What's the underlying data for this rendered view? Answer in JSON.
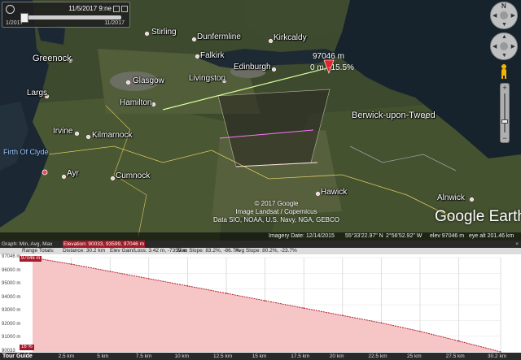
{
  "time_slider": {
    "current": "11/5/2017 9:ne",
    "start": "1/2017",
    "end": "11/2017"
  },
  "map": {
    "places": {
      "stirling": "Stirling",
      "dunfermline": "Dunfermline",
      "kirkcaldy": "Kirkcaldy",
      "greenock": "Greenock",
      "falkirk": "Falkirk",
      "glasgow": "Glasgow",
      "livingston": "Livingston",
      "edinburgh": "Edinburgh",
      "largs": "Largs",
      "hamilton": "Hamilton",
      "berwick": "Berwick-upon-Tweed",
      "irvine": "Irvine",
      "kilmarnock": "Kilmarnock",
      "ayr": "Ayr",
      "cumnock": "Cumnock",
      "hawick": "Hawick",
      "alnwick": "Alnwick",
      "firth": "Firth Of Clyde"
    },
    "marker_distance": "97046 m",
    "marker_info": "0 m, -15.5%",
    "copyright_lines": [
      "© 2017 Google",
      "Image Landsat / Copernicus",
      "Data SIO, NOAA, U.S. Navy, NGA, GEBCO"
    ],
    "logo_part1": "Google",
    "logo_part2": "Earth"
  },
  "status_bar": {
    "imagery_date": "Imagery Date: 12/14/2015",
    "lat": "55°33'22.97\" N",
    "lon": "2°56'52.92\" W",
    "elev": "elev 97046 m",
    "eye_alt": "eye alt 201.46 km"
  },
  "profile": {
    "row1": {
      "graph_label": "Graph: Min, Avg, Max",
      "elevation": "Elevation: 90033, 93599, 97046 m"
    },
    "row2": {
      "range_totals": "Range Totals:",
      "distance": "Distance: 30.2 km",
      "elev_gain": "Elev Gain/Loss: 3.42 m, -7355 m",
      "max_slope": "Max Slope: 83.2%, -86.7%",
      "avg_slope": "Avg Slope: 80.2%, -23.7%"
    },
    "close": "×",
    "tour_guide": "Tour Guide",
    "ymax_label": "97046 m",
    "ymin_label": "16 %",
    "y_ticks": [
      "97046 m",
      "96000 m",
      "95000 m",
      "94000 m",
      "93000 m",
      "92000 m",
      "91000 m",
      "90033"
    ],
    "x_ticks": [
      "2.5 km",
      "5 km",
      "7.5 km",
      "10 km",
      "12.5 km",
      "15 km",
      "17.5 km",
      "20 km",
      "22.5 km",
      "25 km",
      "27.5 km",
      "30.2 km"
    ]
  },
  "colors": {
    "profile_fill": "#f6c6c6",
    "profile_line": "#b02030",
    "elevation_highlight": "#a31a2a"
  },
  "chart_data": {
    "type": "area",
    "title": "",
    "xlabel": "",
    "ylabel": "",
    "xlim": [
      0,
      30.2
    ],
    "ylim": [
      90033,
      97046
    ],
    "series": [
      {
        "x": [
          0,
          2.5,
          5,
          7.5,
          10,
          12.5,
          15,
          17.5,
          20,
          22.5,
          25,
          27.5,
          30.2
        ],
        "values": [
          97046,
          96560,
          96020,
          95480,
          94940,
          94390,
          93840,
          93290,
          92740,
          92190,
          91560,
          90840,
          90033
        ]
      }
    ]
  }
}
